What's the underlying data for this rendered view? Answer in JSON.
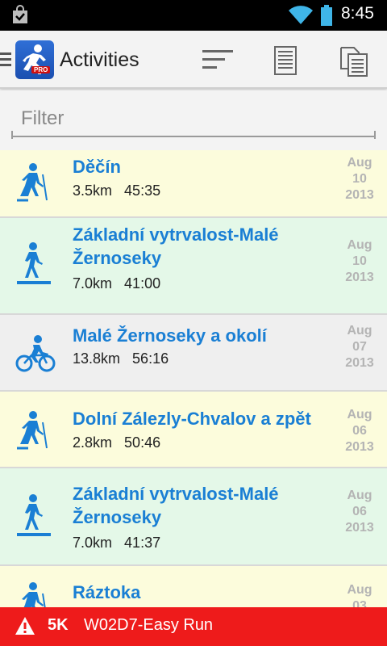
{
  "status_bar": {
    "time": "8:45"
  },
  "action_bar": {
    "title": "Activities"
  },
  "filter": {
    "placeholder": "Filter",
    "value": ""
  },
  "activities": [
    {
      "name": "Děčín",
      "distance": "3.5km",
      "duration": "45:35",
      "month": "Aug",
      "day": "10",
      "year": "2013",
      "type": "hiking",
      "bg": "#fcfcdc"
    },
    {
      "name": "Základní vytrvalost-Malé Žernoseky",
      "distance": "7.0km",
      "duration": "41:00",
      "month": "Aug",
      "day": "10",
      "year": "2013",
      "type": "walking",
      "bg": "#e4f8e8"
    },
    {
      "name": "Malé Žernoseky a okolí",
      "distance": "13.8km",
      "duration": "56:16",
      "month": "Aug",
      "day": "07",
      "year": "2013",
      "type": "cycling",
      "bg": "#efefef"
    },
    {
      "name": "Dolní Zálezly-Chvalov a zpět",
      "distance": "2.8km",
      "duration": "50:46",
      "month": "Aug",
      "day": "06",
      "year": "2013",
      "type": "hiking",
      "bg": "#fcfcdc"
    },
    {
      "name": "Základní vytrvalost-Malé Žernoseky",
      "distance": "7.0km",
      "duration": "41:37",
      "month": "Aug",
      "day": "06",
      "year": "2013",
      "type": "walking",
      "bg": "#e4f8e8"
    },
    {
      "name": "Ráztoka",
      "distance": "",
      "duration": "",
      "month": "Aug",
      "day": "03",
      "year": "",
      "type": "hiking",
      "bg": "#fcfcdc"
    }
  ],
  "alert_bar": {
    "distance": "5K",
    "workout": "W02D7-Easy Run"
  },
  "colors": {
    "accent_blue": "#1a7fd4",
    "alert_red": "#ee1b1b",
    "date_gray": "#b4b4b4"
  }
}
